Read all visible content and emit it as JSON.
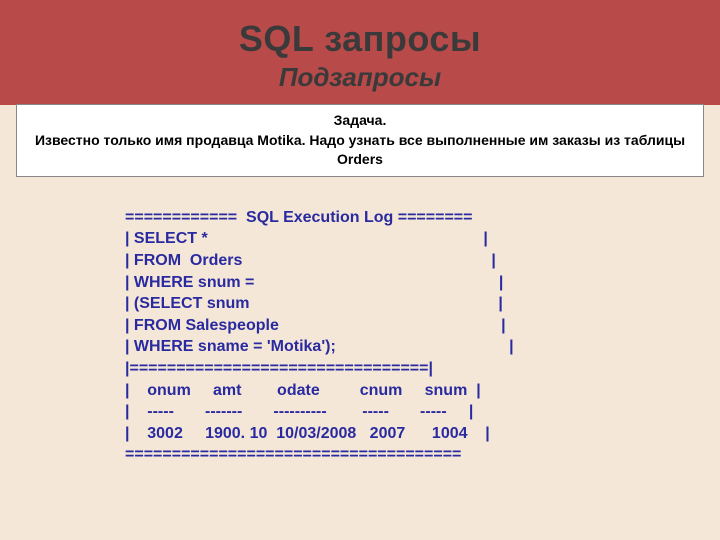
{
  "header": {
    "title": "SQL запросы",
    "subtitle": "Подзапросы"
  },
  "task": {
    "title": "Задача.",
    "text": "Известно только имя продавца Motika. Надо узнать все выполненные им заказы из таблицы Orders"
  },
  "code": {
    "log_header": "============  SQL Execution Log ========",
    "sql": [
      "| SELECT *                                                              |",
      "| FROM  Orders                                                        |",
      "| WHERE snum =                                                       |",
      "| (SELECT snum                                                        |",
      "| FROM Salespeople                                                  |",
      "| WHERE sname = 'Motika');                                       |"
    ],
    "divider": "|================================|",
    "table_header": "|    onum     amt        odate         cnum     snum  |",
    "table_dashes": "|    -----       -------       ----------        -----       -----     |",
    "table_row": "|    3002     1900. 10  10/03/2008   2007      1004    |",
    "footer": "===================================="
  }
}
